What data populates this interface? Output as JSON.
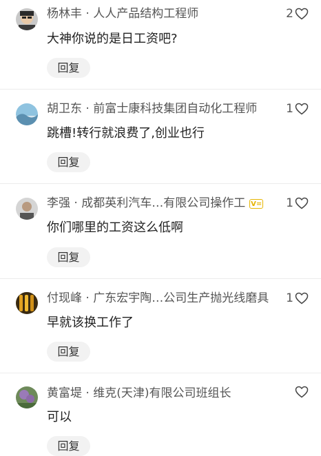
{
  "reply_label": "回复",
  "comments": [
    {
      "author": "杨林丰 · 人人产品结构工程师",
      "text": "大神你说的是日工资吧?",
      "likes": "2",
      "badge": ""
    },
    {
      "author": "胡卫东 · 前富士康科技集团自动化工程师",
      "text": "跳槽!转行就浪费了,创业也行",
      "likes": "1",
      "badge": ""
    },
    {
      "author": "李强 · 成都英利汽车…有限公司操作工",
      "text": "你们哪里的工资这么低啊",
      "likes": "1",
      "badge": "V="
    },
    {
      "author": "付现峰 · 广东宏宇陶…公司生产抛光线磨具",
      "text": "早就该换工作了",
      "likes": "1",
      "badge": ""
    },
    {
      "author": "黄富堤 · 维克(天津)有限公司班组长",
      "text": "可以",
      "likes": "",
      "badge": ""
    }
  ]
}
